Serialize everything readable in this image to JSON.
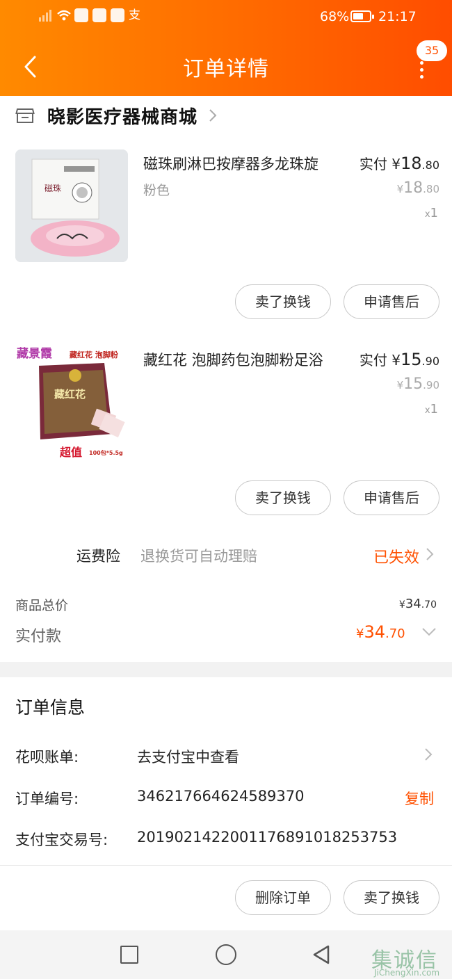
{
  "status_bar": {
    "battery": "68%",
    "time": "21:17",
    "pay_glyph": "支"
  },
  "nav": {
    "title": "订单详情",
    "badge_count": "35"
  },
  "shop": {
    "name": "晓影医疗器械商城"
  },
  "items": [
    {
      "title": "磁珠刷淋巴按摩器多龙珠旋",
      "spec": "粉色",
      "paid_label": "实付",
      "paid_yen": "¥",
      "paid_int": "18",
      "paid_dec": ".80",
      "orig_yen": "¥",
      "orig_int": "18",
      "orig_dec": ".80",
      "qty_x": "x",
      "qty": "1",
      "btn_resell": "卖了换钱",
      "btn_aftersale": "申请售后",
      "thumb_text": "磁珠"
    },
    {
      "title": "藏红花 泡脚药包泡脚粉足浴",
      "spec": "",
      "paid_label": "实付",
      "paid_yen": "¥",
      "paid_int": "15",
      "paid_dec": ".90",
      "orig_yen": "¥",
      "orig_int": "15",
      "orig_dec": ".90",
      "qty_x": "x",
      "qty": "1",
      "btn_resell": "卖了换钱",
      "btn_aftersale": "申请售后",
      "thumb_top_left": "藏景霞",
      "thumb_top_right": "藏红花  泡脚粉",
      "thumb_pack": "藏红花",
      "thumb_bottom_big": "超值",
      "thumb_bottom_small": "100包*5.5g"
    }
  ],
  "freight": {
    "label": "运费险",
    "desc": "退换货可自动理赔",
    "status": "已失效"
  },
  "totals": {
    "goods_label": "商品总价",
    "goods_yen": "¥",
    "goods_int": "34",
    "goods_dec": ".70",
    "paid_label": "实付款",
    "paid_yen": "¥",
    "paid_int": "34",
    "paid_dec": ".70"
  },
  "order_info": {
    "title": "订单信息",
    "rows": [
      {
        "key": "花呗账单:",
        "value": "去支付宝中查看"
      },
      {
        "key": "订单编号:",
        "value": "346217664624589370",
        "action": "复制"
      },
      {
        "key": "支付宝交易号:",
        "value": "2019021422001176891018253753"
      }
    ]
  },
  "bottom_actions": {
    "delete": "删除订单",
    "resell": "卖了换钱"
  },
  "watermark": {
    "cn": "集诚信",
    "en": "JiChengXin.com"
  },
  "colors": {
    "accent": "#ff5000",
    "header_start": "#ff8a00",
    "header_end": "#ff4d00"
  }
}
